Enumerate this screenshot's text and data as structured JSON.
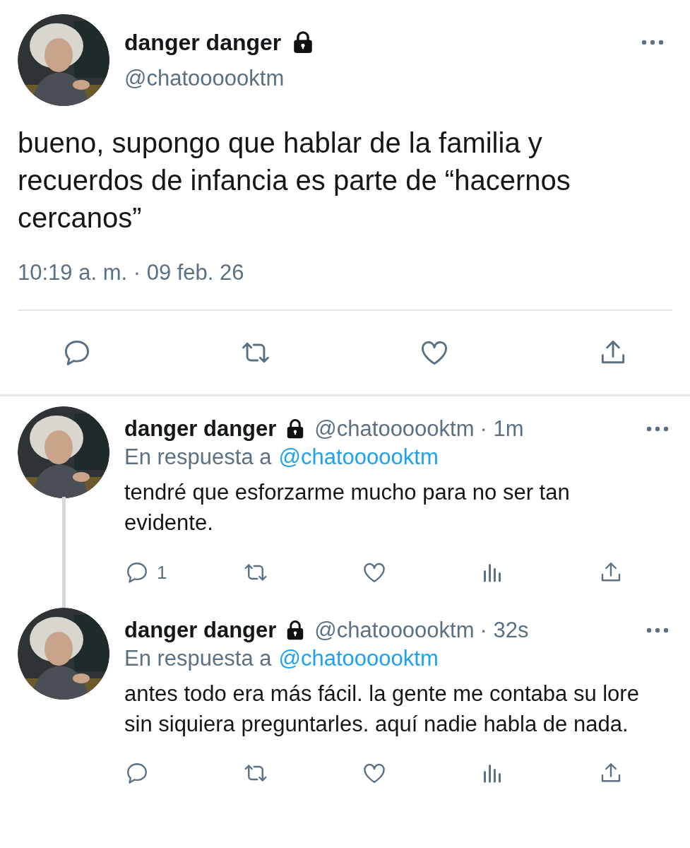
{
  "main_tweet": {
    "author": {
      "name": "danger danger",
      "handle": "@chatoooooktm",
      "locked": true
    },
    "text": "bueno, supongo que hablar de la familia y recuerdos de infancia es parte de “hacernos cercanos”",
    "timestamp": "10:19 a. m. · 09 feb. 26",
    "actions": [
      {
        "kind": "reply"
      },
      {
        "kind": "retweet"
      },
      {
        "kind": "like"
      },
      {
        "kind": "share"
      }
    ]
  },
  "replies": [
    {
      "author": {
        "name": "danger danger",
        "handle": "@chatoooooktm",
        "locked": true
      },
      "time": "· 1m",
      "reply_to_label": "En respuesta a",
      "reply_to": "@chatoooooktm",
      "text": "tendré que esforzarme mucho para no ser tan evidente.",
      "thread_line": true,
      "actions": [
        {
          "kind": "reply",
          "count": "1"
        },
        {
          "kind": "retweet"
        },
        {
          "kind": "like"
        },
        {
          "kind": "stats"
        },
        {
          "kind": "share"
        }
      ]
    },
    {
      "author": {
        "name": "danger danger",
        "handle": "@chatoooooktm",
        "locked": true
      },
      "time": "· 32s",
      "reply_to_label": "En respuesta a",
      "reply_to": "@chatoooooktm",
      "text": "antes todo era más fácil. la gente me contaba su lore sin siquiera preguntarles. aquí nadie habla de nada.",
      "thread_line": false,
      "actions": [
        {
          "kind": "reply"
        },
        {
          "kind": "retweet"
        },
        {
          "kind": "like"
        },
        {
          "kind": "stats"
        },
        {
          "kind": "share"
        }
      ]
    }
  ]
}
